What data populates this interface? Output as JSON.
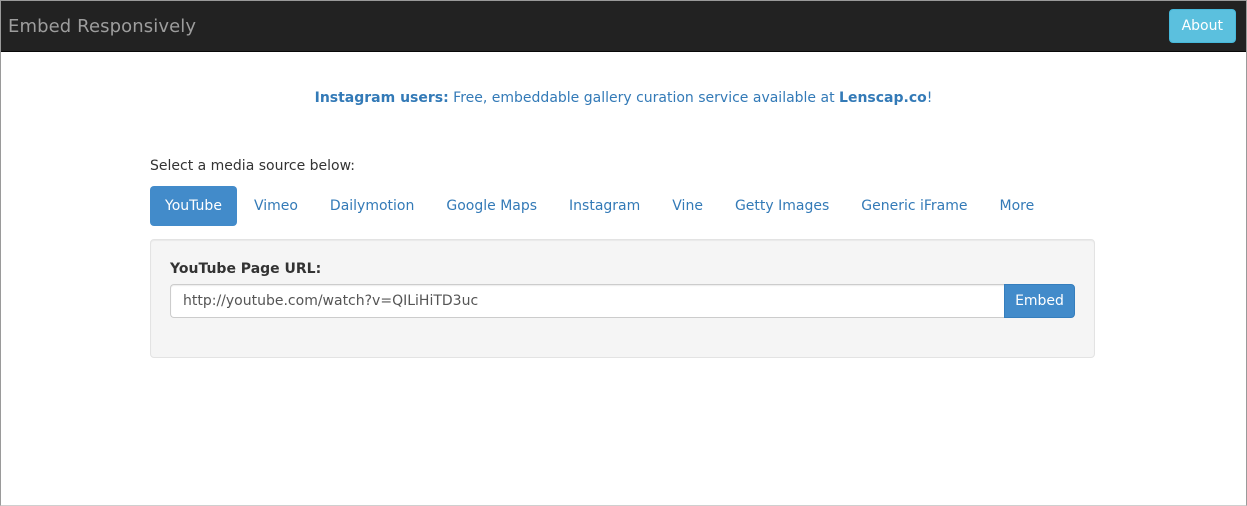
{
  "navbar": {
    "brand": "Embed Responsively",
    "about_label": "About"
  },
  "promo": {
    "bold_prefix": "Instagram users:",
    "text": " Free, embeddable gallery curation service available at ",
    "link": "Lenscap.co",
    "suffix": "!"
  },
  "prompt": "Select a media source below:",
  "tabs": [
    {
      "label": "YouTube",
      "active": true
    },
    {
      "label": "Vimeo",
      "active": false
    },
    {
      "label": "Dailymotion",
      "active": false
    },
    {
      "label": "Google Maps",
      "active": false
    },
    {
      "label": "Instagram",
      "active": false
    },
    {
      "label": "Vine",
      "active": false
    },
    {
      "label": "Getty Images",
      "active": false
    },
    {
      "label": "Generic iFrame",
      "active": false
    },
    {
      "label": "More",
      "active": false
    }
  ],
  "form": {
    "label": "YouTube Page URL:",
    "url_value": "http://youtube.com/watch?v=QILiHiTD3uc",
    "embed_label": "Embed"
  },
  "colors": {
    "navbar_bg": "#222222",
    "accent": "#428bca",
    "link": "#337ab7",
    "about_btn": "#5bc0de"
  }
}
